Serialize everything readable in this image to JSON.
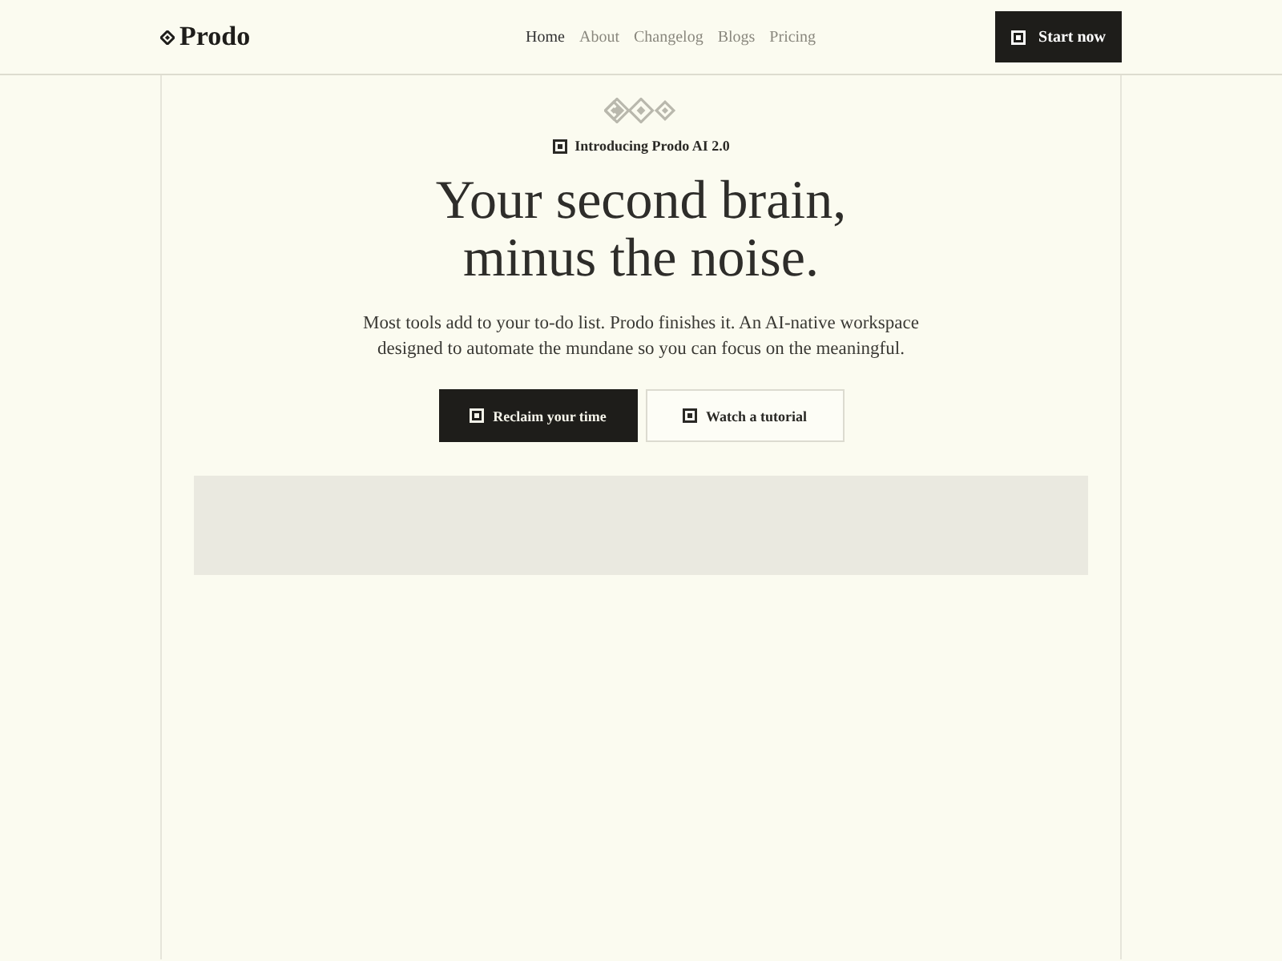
{
  "header": {
    "logo": "Prodo",
    "nav": [
      {
        "label": "Home",
        "selected": true
      },
      {
        "label": "About",
        "selected": false
      },
      {
        "label": "Changelog",
        "selected": false
      },
      {
        "label": "Blogs",
        "selected": false
      },
      {
        "label": "Pricing",
        "selected": false
      }
    ],
    "cta": "Start now"
  },
  "hero": {
    "badge": "Introducing Prodo AI 2.0",
    "title_lines": [
      "Your second brain,",
      "minus the noise."
    ],
    "subtitle": "Most tools add to your to-do list. Prodo finishes it. An AI-native workspace designed to automate the mundane so you can focus on the meaningful.",
    "buttons": [
      {
        "label": "Reclaim your time",
        "kind": "primary"
      },
      {
        "label": "Watch a tutorial",
        "kind": "secondary"
      }
    ]
  },
  "preview": {
    "kind": "placeholder"
  }
}
